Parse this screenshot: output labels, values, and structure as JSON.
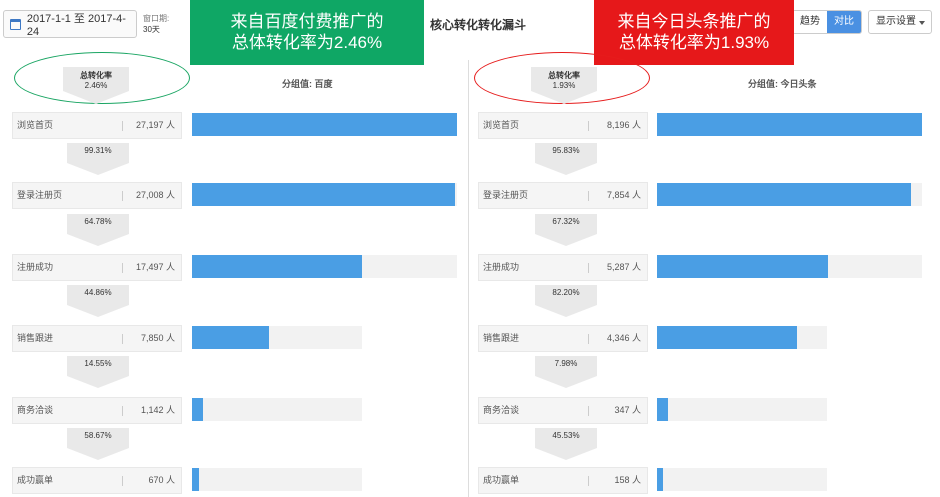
{
  "toolbar": {
    "date_range": "2017-1-1 至 2017-4-24",
    "window_label": "窗口期:",
    "window_value": "30天",
    "title": "核心转化转化漏斗",
    "trend_label": "趋势",
    "compare_label": "对比",
    "display_label": "显示设置"
  },
  "callouts": {
    "left_line1": "来自百度付费推广的",
    "left_line2": "总体转化率为2.46%",
    "right_line1": "来自今日头条推广的",
    "right_line2": "总体转化率为1.93%"
  },
  "colors": {
    "bar": "#4a9ee4",
    "green": "#0fa765",
    "red": "#e6181a"
  },
  "left": {
    "total_label": "总转化率",
    "total_value": "2.46%",
    "group_label": "分组值: 百度",
    "steps": [
      {
        "name": "浏览首页",
        "value": "27,197 人",
        "ratio": 1.0
      },
      {
        "name": "登录注册页",
        "value": "27,008 人",
        "ratio": 0.993
      },
      {
        "name": "注册成功",
        "value": "17,497 人",
        "ratio": 0.643
      },
      {
        "name": "销售跟进",
        "value": "7,850 人",
        "ratio": 0.289
      },
      {
        "name": "商务洽谈",
        "value": "1,142 人",
        "ratio": 0.042
      },
      {
        "name": "成功赢单",
        "value": "670 人",
        "ratio": 0.025
      }
    ],
    "rates": [
      "99.31%",
      "64.78%",
      "44.86%",
      "14.55%",
      "58.67%"
    ]
  },
  "right": {
    "total_label": "总转化率",
    "total_value": "1.93%",
    "group_label": "分组值: 今日头条",
    "steps": [
      {
        "name": "浏览首页",
        "value": "8,196 人",
        "ratio": 1.0
      },
      {
        "name": "登录注册页",
        "value": "7,854 人",
        "ratio": 0.958
      },
      {
        "name": "注册成功",
        "value": "5,287 人",
        "ratio": 0.645
      },
      {
        "name": "销售跟进",
        "value": "4,346 人",
        "ratio": 0.53
      },
      {
        "name": "商务洽谈",
        "value": "347 人",
        "ratio": 0.042
      },
      {
        "name": "成功赢单",
        "value": "158 人",
        "ratio": 0.019
      }
    ],
    "rates": [
      "95.83%",
      "67.32%",
      "82.20%",
      "7.98%",
      "45.53%"
    ]
  }
}
